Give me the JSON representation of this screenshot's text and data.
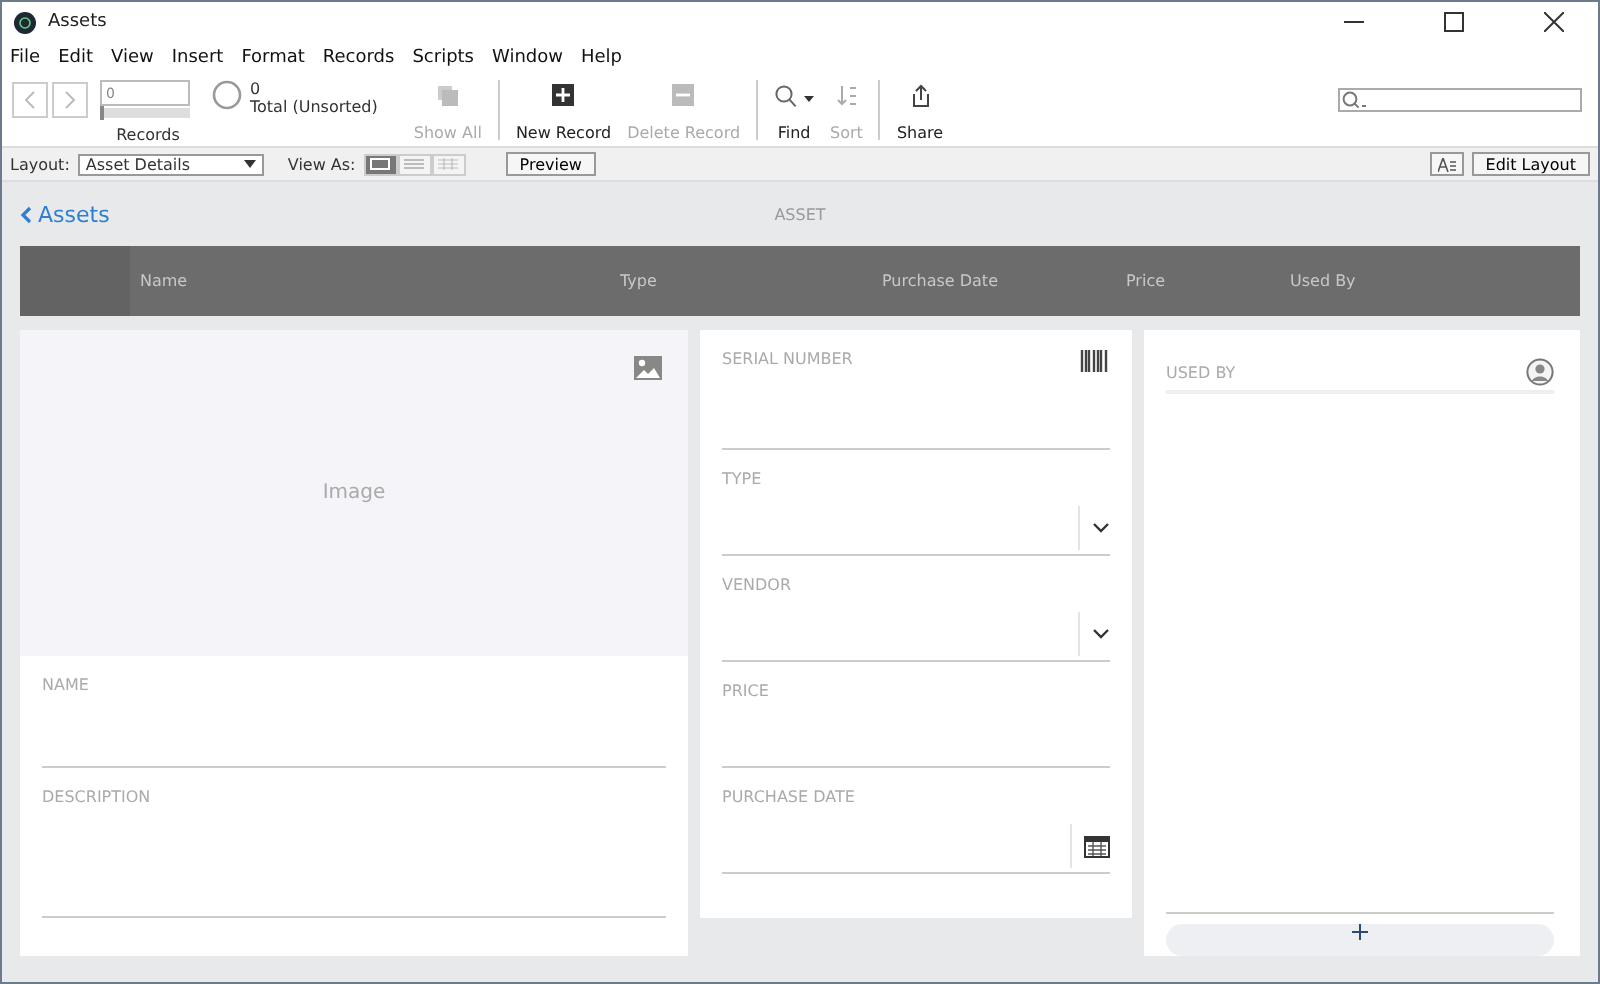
{
  "window": {
    "title": "Assets"
  },
  "menu": [
    "File",
    "Edit",
    "View",
    "Insert",
    "Format",
    "Records",
    "Scripts",
    "Window",
    "Help"
  ],
  "toolbar": {
    "record_value": "0",
    "records_label": "Records",
    "record_slider": {
      "level": 0
    },
    "found_count": "0",
    "found_label": "Total (Unsorted)",
    "buttons": [
      {
        "kind": "showall",
        "label": "Show All",
        "disabled": true
      },
      {
        "kind": "new",
        "label": "New Record",
        "disabled": false
      },
      {
        "kind": "delete",
        "label": "Delete Record",
        "disabled": true
      },
      {
        "kind": "find",
        "label": "Find",
        "disabled": false
      },
      {
        "kind": "sort",
        "label": "Sort",
        "disabled": true
      },
      {
        "kind": "share",
        "label": "Share",
        "disabled": false
      }
    ]
  },
  "layout_bar": {
    "layout_label": "Layout:",
    "layout_value": "Asset Details",
    "view_as_label": "View As:",
    "view_modes": [
      {
        "kind": "form",
        "selected": true
      },
      {
        "kind": "list",
        "selected": false
      },
      {
        "kind": "table",
        "selected": false
      }
    ],
    "preview": "Preview",
    "edit_layout": "Edit Layout"
  },
  "nav": {
    "back": "Assets",
    "title": "ASSET"
  },
  "table": {
    "columns": [
      "Name",
      "Type",
      "Purchase Date",
      "Price",
      "Used By"
    ]
  },
  "image_panel": {
    "placeholder": "Image"
  },
  "left_fields": [
    {
      "label": "NAME",
      "kind": "text"
    },
    {
      "label": "DESCRIPTION",
      "kind": "multiline"
    }
  ],
  "middle_fields": [
    {
      "label": "SERIAL NUMBER",
      "kind": "barcode"
    },
    {
      "label": "TYPE",
      "kind": "dropdown"
    },
    {
      "label": "VENDOR",
      "kind": "dropdown"
    },
    {
      "label": "PRICE",
      "kind": "text"
    },
    {
      "label": "PURCHASE DATE",
      "kind": "date"
    }
  ],
  "used_by": {
    "label": "USED BY"
  }
}
